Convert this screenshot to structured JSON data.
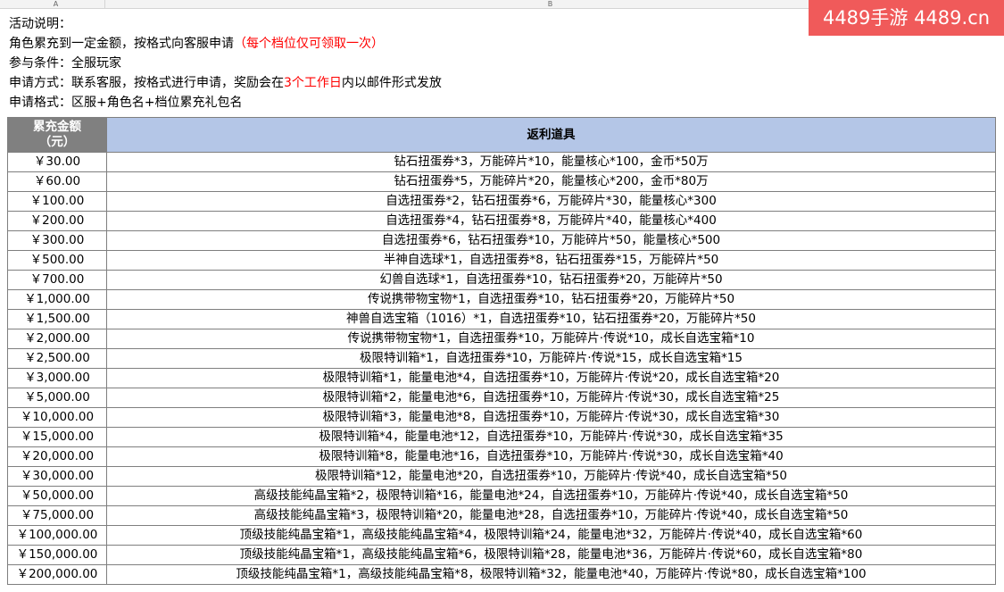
{
  "sheet": {
    "col_a": "A",
    "col_b": "B"
  },
  "watermark": {
    "text": "4489手游 4489.cn"
  },
  "intro": {
    "line1": "活动说明：",
    "line2_main": "角色累充到一定金额，按格式向客服申请",
    "line2_note": "（每个档位仅可领取一次）",
    "line3": "参与条件：全服玩家",
    "line4_a": "申请方式：联系客服，按格式进行申请，奖励会在",
    "line4_red": "3个工作日",
    "line4_b": "内以邮件形式发放",
    "line5": "申请格式：区服+角色名+档位累充礼包名"
  },
  "table": {
    "header_amount": "累充金额\n（元）",
    "header_reward": "返利道具",
    "rows": [
      {
        "amount": "￥30.00",
        "reward": "钻石扭蛋券*3，万能碎片*10，能量核心*100，金币*50万"
      },
      {
        "amount": "￥60.00",
        "reward": "钻石扭蛋券*5，万能碎片*20，能量核心*200，金币*80万"
      },
      {
        "amount": "￥100.00",
        "reward": "自选扭蛋券*2，钻石扭蛋券*6，万能碎片*30，能量核心*300"
      },
      {
        "amount": "￥200.00",
        "reward": "自选扭蛋券*4，钻石扭蛋券*8，万能碎片*40，能量核心*400"
      },
      {
        "amount": "￥300.00",
        "reward": "自选扭蛋券*6，钻石扭蛋券*10，万能碎片*50，能量核心*500"
      },
      {
        "amount": "￥500.00",
        "reward": "半神自选球*1，自选扭蛋券*8，钻石扭蛋券*15，万能碎片*50"
      },
      {
        "amount": "￥700.00",
        "reward": "幻兽自选球*1，自选扭蛋券*10，钻石扭蛋券*20，万能碎片*50"
      },
      {
        "amount": "￥1,000.00",
        "reward": "传说携带物宝物*1，自选扭蛋券*10，钻石扭蛋券*20，万能碎片*50"
      },
      {
        "amount": "￥1,500.00",
        "reward": "神兽自选宝箱（1016）*1，自选扭蛋券*10，钻石扭蛋券*20，万能碎片*50"
      },
      {
        "amount": "￥2,000.00",
        "reward": "传说携带物宝物*1，自选扭蛋券*10，万能碎片·传说*10，成长自选宝箱*10"
      },
      {
        "amount": "￥2,500.00",
        "reward": "极限特训箱*1，自选扭蛋券*10，万能碎片·传说*15，成长自选宝箱*15"
      },
      {
        "amount": "￥3,000.00",
        "reward": "极限特训箱*1，能量电池*4，自选扭蛋券*10，万能碎片·传说*20，成长自选宝箱*20"
      },
      {
        "amount": "￥5,000.00",
        "reward": "极限特训箱*2，能量电池*6，自选扭蛋券*10，万能碎片·传说*30，成长自选宝箱*25"
      },
      {
        "amount": "￥10,000.00",
        "reward": "极限特训箱*3，能量电池*8，自选扭蛋券*10，万能碎片·传说*30，成长自选宝箱*30"
      },
      {
        "amount": "￥15,000.00",
        "reward": "极限特训箱*4，能量电池*12，自选扭蛋券*10，万能碎片·传说*30，成长自选宝箱*35"
      },
      {
        "amount": "￥20,000.00",
        "reward": "极限特训箱*8，能量电池*16，自选扭蛋券*10，万能碎片·传说*30，成长自选宝箱*40"
      },
      {
        "amount": "￥30,000.00",
        "reward": "极限特训箱*12，能量电池*20，自选扭蛋券*10，万能碎片·传说*40，成长自选宝箱*50"
      },
      {
        "amount": "￥50,000.00",
        "reward": "高级技能纯晶宝箱*2，极限特训箱*16，能量电池*24，自选扭蛋券*10，万能碎片·传说*40，成长自选宝箱*50"
      },
      {
        "amount": "￥75,000.00",
        "reward": "高级技能纯晶宝箱*3，极限特训箱*20，能量电池*28，自选扭蛋券*10，万能碎片·传说*40，成长自选宝箱*50"
      },
      {
        "amount": "￥100,000.00",
        "reward": "顶级技能纯晶宝箱*1，高级技能纯晶宝箱*4，极限特训箱*24，能量电池*32，万能碎片·传说*40，成长自选宝箱*60"
      },
      {
        "amount": "￥150,000.00",
        "reward": "顶级技能纯晶宝箱*1，高级技能纯晶宝箱*6，极限特训箱*28，能量电池*36，万能碎片·传说*60，成长自选宝箱*80"
      },
      {
        "amount": "￥200,000.00",
        "reward": "顶级技能纯晶宝箱*1，高级技能纯晶宝箱*8，极限特训箱*32，能量电池*40，万能碎片·传说*80，成长自选宝箱*100"
      }
    ]
  }
}
